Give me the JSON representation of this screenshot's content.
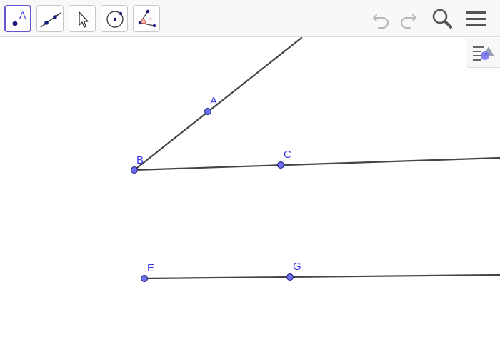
{
  "toolbar": {
    "tools": [
      {
        "name": "point-tool",
        "label_glyph": "A",
        "active": true
      },
      {
        "name": "line-tool",
        "active": false
      },
      {
        "name": "move-tool",
        "active": false
      },
      {
        "name": "circle-tool",
        "active": false
      },
      {
        "name": "angle-tool",
        "label_glyph": "α",
        "active": false
      }
    ],
    "controls": [
      "undo-icon",
      "redo-icon",
      "search-icon",
      "menu-icon"
    ]
  },
  "style_bar_toggle": {
    "icon": "style-bar-icon"
  },
  "points": {
    "A": "A",
    "B": "B",
    "C": "C",
    "E": "E",
    "G": "G"
  },
  "colors": {
    "point_fill": "#6e6ef0",
    "label": "#3c3ce6",
    "line": "#444444",
    "accent": "#6557d2"
  }
}
